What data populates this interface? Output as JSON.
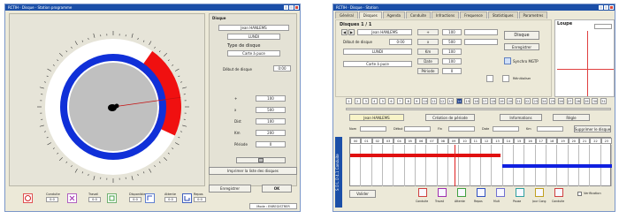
{
  "left": {
    "title": "RCTIH  ·  Disque · Station programme",
    "group_title": "Disque",
    "user_label": "Jean HANLEMS",
    "type_value": "LUNDI",
    "type_heading": "Type de disque",
    "type_field": "Carte à puce",
    "debut_label": "Début de disque",
    "debut_value": "0:00",
    "mid_rows": [
      {
        "label": "+",
        "value": "100"
      },
      {
        "label": "x",
        "value": "500"
      },
      {
        "label": "Dist",
        "value": "100"
      },
      {
        "label": "Km",
        "value": "200"
      },
      {
        "label": "Période",
        "value": "0"
      }
    ],
    "print_button": "Imprimer la liste des disques",
    "save_button": "Enregistrer",
    "ok_button": "OK",
    "legend": [
      {
        "label": "Conduite",
        "value": "0:0"
      },
      {
        "label": "Travail",
        "value": "0:0"
      },
      {
        "label": "Disponible",
        "value": "0:0"
      },
      {
        "label": "Attente",
        "value": "0:0"
      },
      {
        "label": "Repos",
        "value": "0:0"
      }
    ],
    "status": "Mode : ENREGISTRER",
    "colors": {
      "ring_blue": "#1030d8",
      "arc_red": "#f01010",
      "dial_gray": "#c0c0c0"
    }
  },
  "right": {
    "title": "RCTIH  ·  Disque · Station",
    "tabs": [
      "Général",
      "Disques",
      "Agenda",
      "Conduite",
      "Infractions",
      "Frequence",
      "Statistiques",
      "Parametres"
    ],
    "selected_tab": 1,
    "section_title": "Disques  1 / 1",
    "user_label": "Jean HANLEMS",
    "debut_label": "Début de disque",
    "debut_value": "0:00",
    "type_value": "LUNDI",
    "card_label": "Carte à puce",
    "center_rows": [
      {
        "label": "+",
        "value": "100"
      },
      {
        "label": "x",
        "value": "500"
      },
      {
        "label": "Km",
        "value": "100"
      },
      {
        "label": "Date",
        "value": "100"
      },
      {
        "label": "Période",
        "value": "0"
      }
    ],
    "disque_button": "Disque",
    "enregistrer_button": "Enregistrer",
    "synchro_label": "Synchro MGTP",
    "reinit_label": "Réinitialiser",
    "loupe_title": "Loupe",
    "timeline": [
      "1",
      "2",
      "3",
      "4",
      "5",
      "6",
      "7",
      "8",
      "9",
      "10",
      "11",
      "12",
      "13",
      "14",
      "15",
      "16",
      "17",
      "18",
      "19",
      "20",
      "21",
      "22",
      "23",
      "24",
      "25",
      "26",
      "27",
      "28",
      "29",
      "30",
      "31"
    ],
    "selected_day": "14",
    "driver_field": "Jean HANLEMS",
    "mid_buttons": [
      "Création de période",
      "Informations",
      "Règle"
    ],
    "suppr_button": "Supprimer le disque",
    "filter_labels": [
      "Nom",
      "Début",
      "Fin",
      "Date",
      "Km"
    ],
    "grid_hours": [
      "00",
      "01",
      "02",
      "03",
      "04",
      "05",
      "06",
      "07",
      "08",
      "09",
      "10",
      "11",
      "12",
      "13",
      "14",
      "15",
      "16",
      "17",
      "18",
      "19",
      "20",
      "21",
      "22",
      "23"
    ],
    "side_strip": "S O L O  4.1  Conduite",
    "valider_button": "Valider",
    "bottom_icons": [
      {
        "name": "conduite",
        "label": "Conduite"
      },
      {
        "name": "travail",
        "label": "Travail"
      },
      {
        "name": "attente",
        "label": "Attente"
      },
      {
        "name": "repos",
        "label": "Repos"
      },
      {
        "name": "mult",
        "label": "Mult"
      },
      {
        "name": "pause",
        "label": "Pause"
      },
      {
        "name": "cong",
        "label": "Jour Cong."
      },
      {
        "name": "conduite2",
        "label": "Conduite"
      }
    ],
    "option_label": "Verification",
    "colors": {
      "red_bar": "#e01010",
      "blue_bar": "#1020e0",
      "selected": "#1b3f8f"
    }
  }
}
